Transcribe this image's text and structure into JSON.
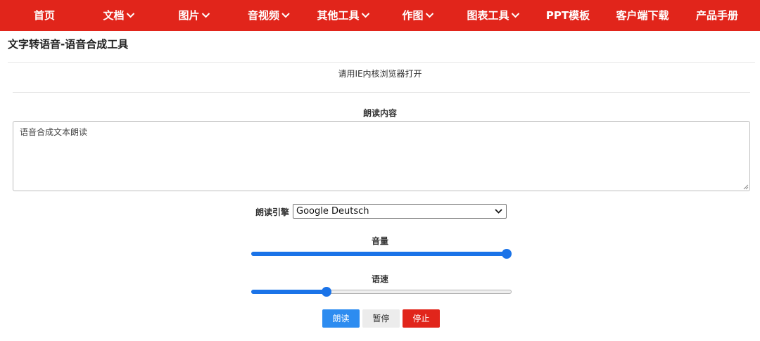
{
  "nav": {
    "items": [
      {
        "label": "首页",
        "has_dropdown": false
      },
      {
        "label": "文档",
        "has_dropdown": true
      },
      {
        "label": "图片",
        "has_dropdown": true
      },
      {
        "label": "音视频",
        "has_dropdown": true
      },
      {
        "label": "其他工具",
        "has_dropdown": true
      },
      {
        "label": "作图",
        "has_dropdown": true
      },
      {
        "label": "图表工具",
        "has_dropdown": true
      },
      {
        "label": "PPT模板",
        "has_dropdown": false
      },
      {
        "label": "客户端下载",
        "has_dropdown": false
      },
      {
        "label": "产品手册",
        "has_dropdown": false
      }
    ],
    "dropdown_icon": "chevron-down-icon",
    "background": "#e1251b"
  },
  "page": {
    "title": "文字转语音-语音合成工具",
    "notice": "请用IE内核浏览器打开"
  },
  "form": {
    "content_label": "朗读内容",
    "content_value": "语音合成文本朗读",
    "engine_label": "朗读引擎",
    "engine_selected": "Google Deutsch",
    "volume_label": "音量",
    "volume_level": 1.0,
    "rate_label": "语速",
    "rate_level": 0.28
  },
  "buttons": {
    "read": "朗读",
    "pause": "暂停",
    "stop": "停止"
  },
  "colors": {
    "accent_red": "#e1251b",
    "accent_blue": "#2d8cf0",
    "slider_blue": "#1a73e8"
  }
}
